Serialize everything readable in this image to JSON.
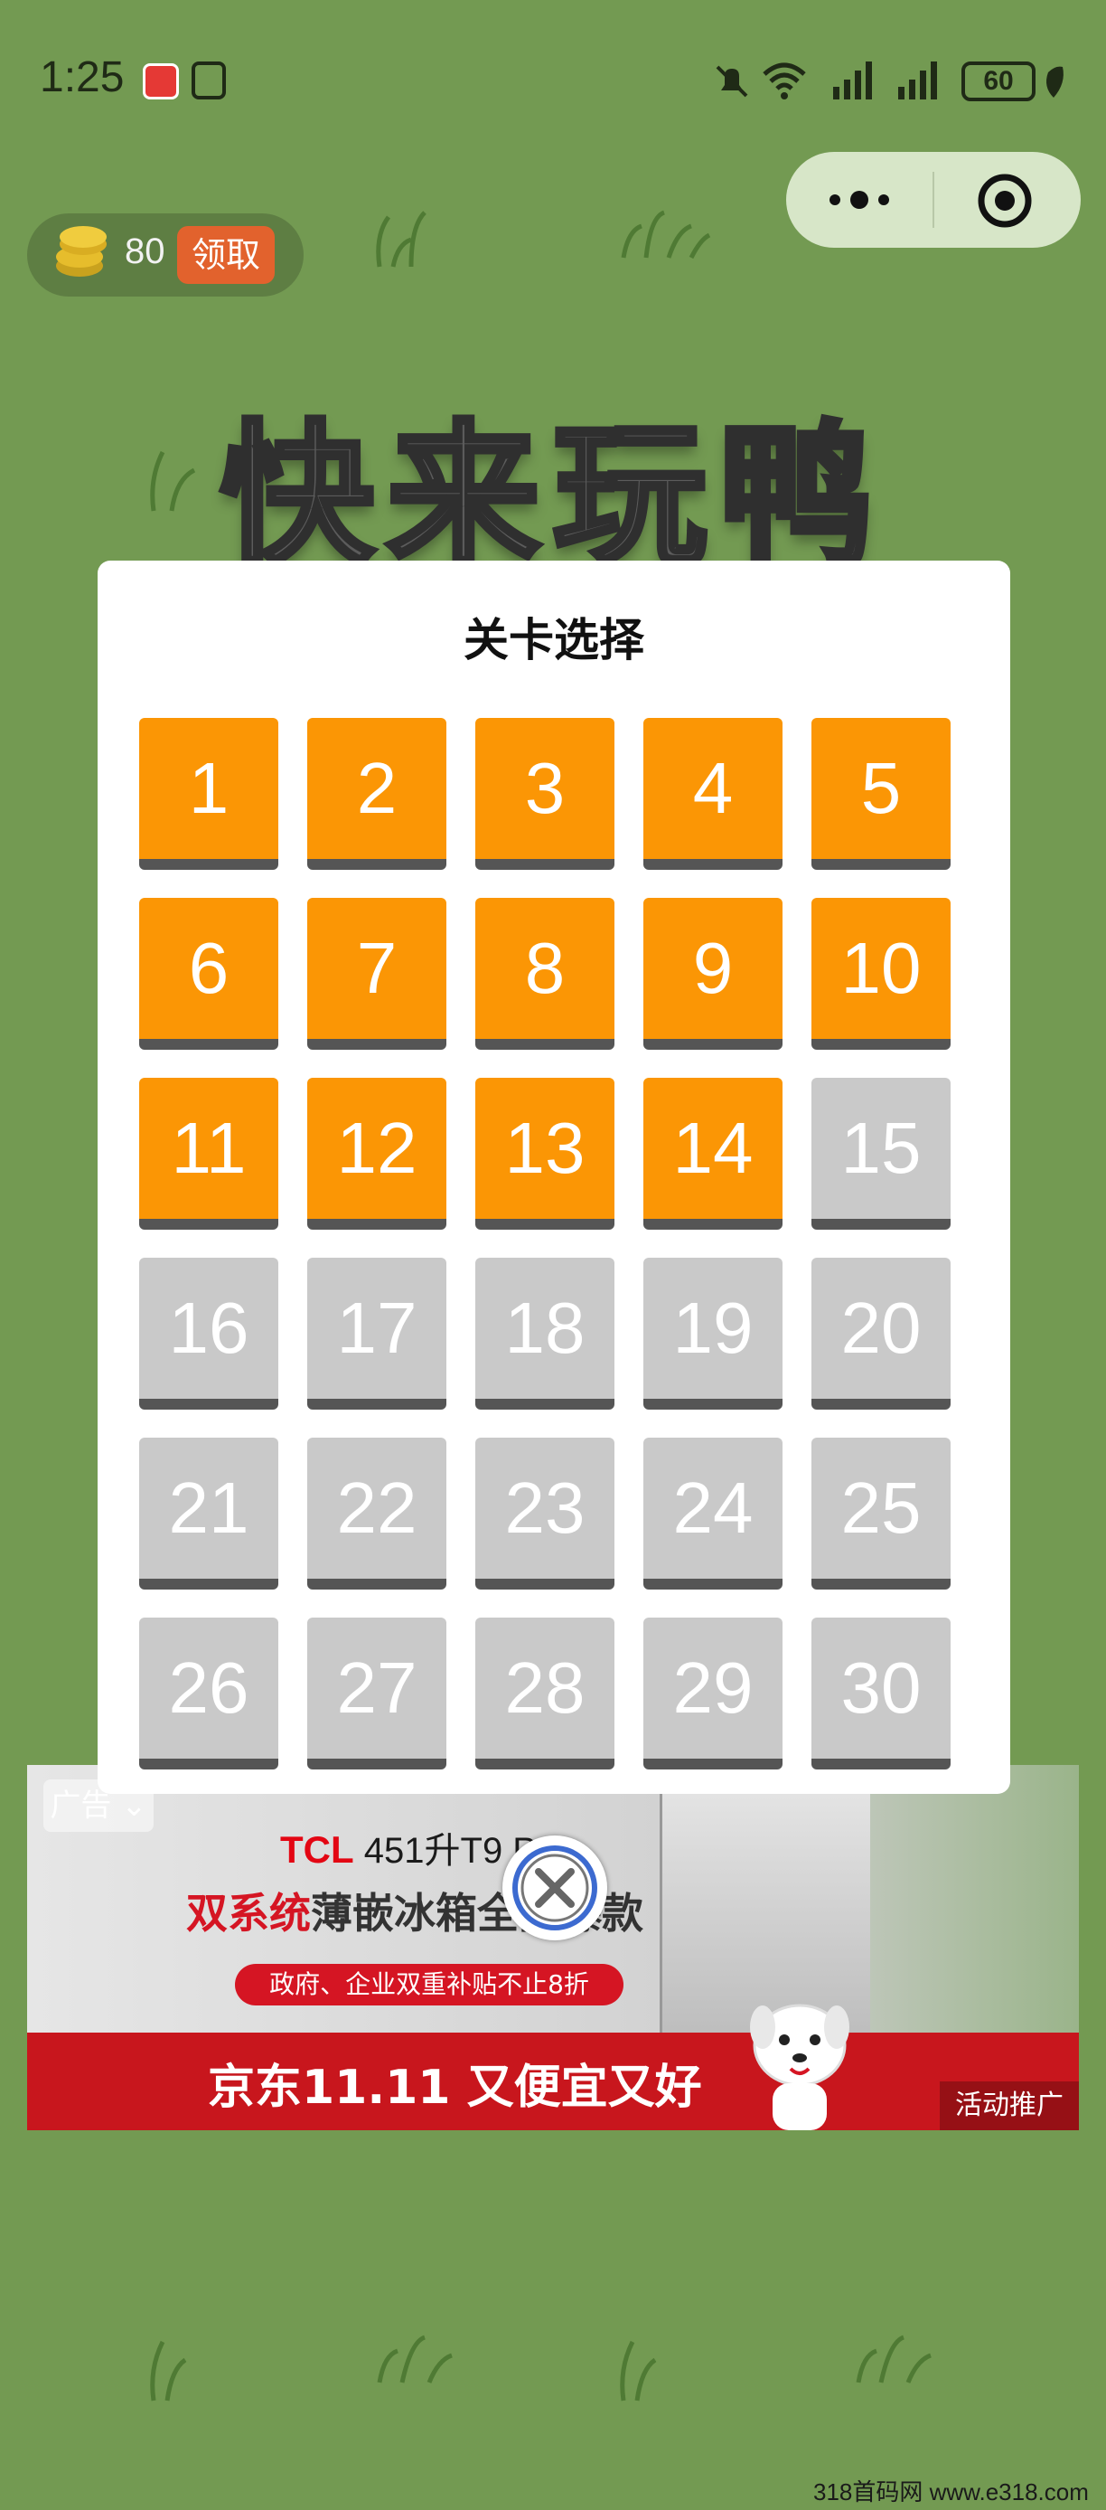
{
  "status_bar": {
    "time": "1:25",
    "battery": "60"
  },
  "coin": {
    "count": "80",
    "claim_label": "领取"
  },
  "game": {
    "title": "快来玩鸭"
  },
  "level_select": {
    "title": "关卡选择",
    "levels": [
      {
        "num": "1",
        "unlocked": true
      },
      {
        "num": "2",
        "unlocked": true
      },
      {
        "num": "3",
        "unlocked": true
      },
      {
        "num": "4",
        "unlocked": true
      },
      {
        "num": "5",
        "unlocked": true
      },
      {
        "num": "6",
        "unlocked": true
      },
      {
        "num": "7",
        "unlocked": true
      },
      {
        "num": "8",
        "unlocked": true
      },
      {
        "num": "9",
        "unlocked": true
      },
      {
        "num": "10",
        "unlocked": true
      },
      {
        "num": "11",
        "unlocked": true
      },
      {
        "num": "12",
        "unlocked": true
      },
      {
        "num": "13",
        "unlocked": true
      },
      {
        "num": "14",
        "unlocked": true
      },
      {
        "num": "15",
        "unlocked": false
      },
      {
        "num": "16",
        "unlocked": false
      },
      {
        "num": "17",
        "unlocked": false
      },
      {
        "num": "18",
        "unlocked": false
      },
      {
        "num": "19",
        "unlocked": false
      },
      {
        "num": "20",
        "unlocked": false
      },
      {
        "num": "21",
        "unlocked": false
      },
      {
        "num": "22",
        "unlocked": false
      },
      {
        "num": "23",
        "unlocked": false
      },
      {
        "num": "24",
        "unlocked": false
      },
      {
        "num": "25",
        "unlocked": false
      },
      {
        "num": "26",
        "unlocked": false
      },
      {
        "num": "27",
        "unlocked": false
      },
      {
        "num": "28",
        "unlocked": false
      },
      {
        "num": "29",
        "unlocked": false
      },
      {
        "num": "30",
        "unlocked": false
      }
    ]
  },
  "ad": {
    "label": "广告",
    "brand": "TCL",
    "model": "451升T9 P",
    "headline_red": "双系统",
    "headline_dark": "薄嵌冰箱全网爆款",
    "subsidy": "政府、企业双重补贴不止8折",
    "slogan": "京东11.11 又便宜又好",
    "promo_tag": "活动推广"
  },
  "watermark": "318首码网 www.e318.com",
  "colors": {
    "background": "#739a52",
    "tile_open": "#fb9605",
    "tile_locked": "#c9c9c9",
    "claim": "#e2622d"
  }
}
